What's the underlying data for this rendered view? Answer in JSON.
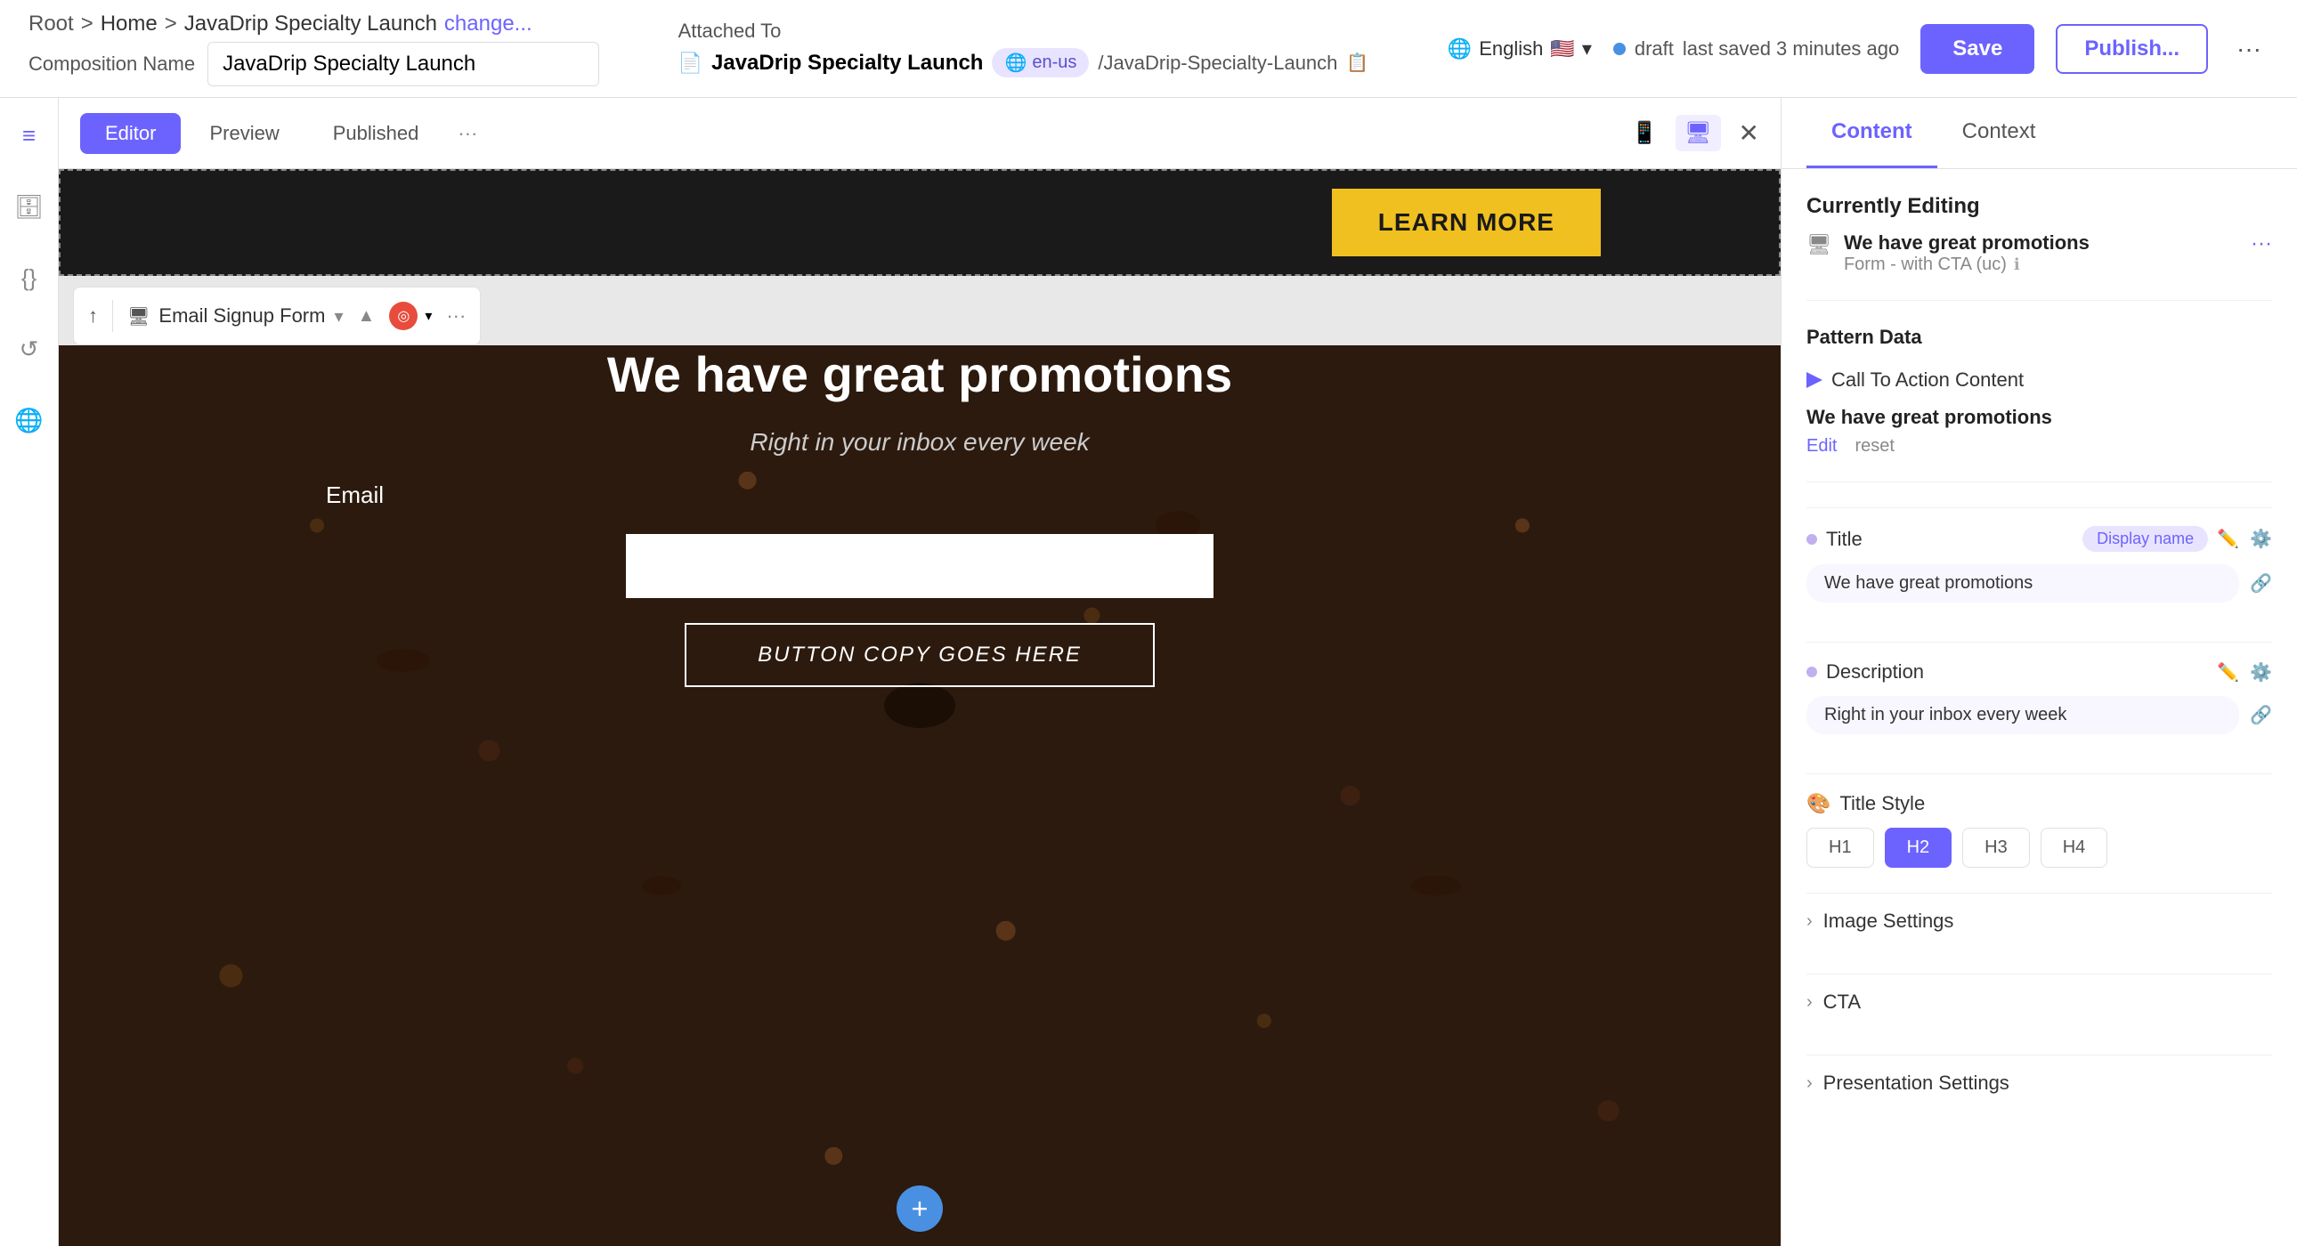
{
  "topbar": {
    "breadcrumb": {
      "root": "Root",
      "sep1": ">",
      "home": "Home",
      "sep2": ">",
      "page": "JavaDrip Specialty Launch",
      "change": "change..."
    },
    "comp_name_label": "Composition Name",
    "comp_name_value": "JavaDrip Specialty Launch",
    "attached_to": "Attached To",
    "attached_name": "JavaDrip Specialty Launch",
    "locale": "en-us",
    "locale_prefix": "🌐",
    "attached_path": "/JavaDrip-Specialty-Launch",
    "lang": "English",
    "lang_flag": "🇺🇸",
    "draft_label": "draft",
    "last_saved": "last saved 3 minutes ago",
    "save_label": "Save",
    "publish_label": "Publish...",
    "more_label": "···"
  },
  "editor_toolbar": {
    "tab_editor": "Editor",
    "tab_preview": "Preview",
    "tab_published": "Published",
    "tab_more": "···"
  },
  "sidebar_icons": {
    "layers": "≡",
    "data": "◎",
    "code": "{}",
    "history": "↺",
    "globe": "🌐"
  },
  "component_toolbar": {
    "back_icon": "↑",
    "type_icon": "🖥",
    "type_label": "Email Signup Form",
    "dropdown_icon": "▾",
    "up_arrow": "▲",
    "target_icon": "◎",
    "more_label": "···"
  },
  "canvas": {
    "learn_more_btn": "LEARN MORE",
    "form_title": "We have great promotions",
    "form_subtitle": "Right in your inbox every week",
    "email_label": "Email",
    "email_placeholder": "",
    "button_label": "BUTTON COPY GOES HERE",
    "add_section_label": "+"
  },
  "right_panel": {
    "tab_content": "Content",
    "tab_context": "Context",
    "currently_editing_title": "Currently Editing",
    "editing_item_icon": "🖥",
    "editing_item_name": "We have great promotions",
    "editing_item_type": "Form - with CTA (uc)",
    "editing_item_more": "···",
    "pattern_data_title": "Pattern Data",
    "pattern_icon": "▶",
    "cta_content_label": "Call To Action Content",
    "pattern_value": "We have great promotions",
    "edit_label": "Edit",
    "reset_label": "reset",
    "title_field_label": "Title",
    "display_name_badge": "Display name",
    "title_value": "We have great promotions",
    "desc_field_label": "Description",
    "desc_value": "Right in your inbox every week",
    "title_style_label": "Title Style",
    "title_style_icon": "🎨",
    "h1_label": "H1",
    "h2_label": "H2",
    "h3_label": "H3",
    "h4_label": "H4",
    "image_settings_label": "Image Settings",
    "cta_label": "CTA",
    "presentation_label": "Presentation Settings"
  }
}
